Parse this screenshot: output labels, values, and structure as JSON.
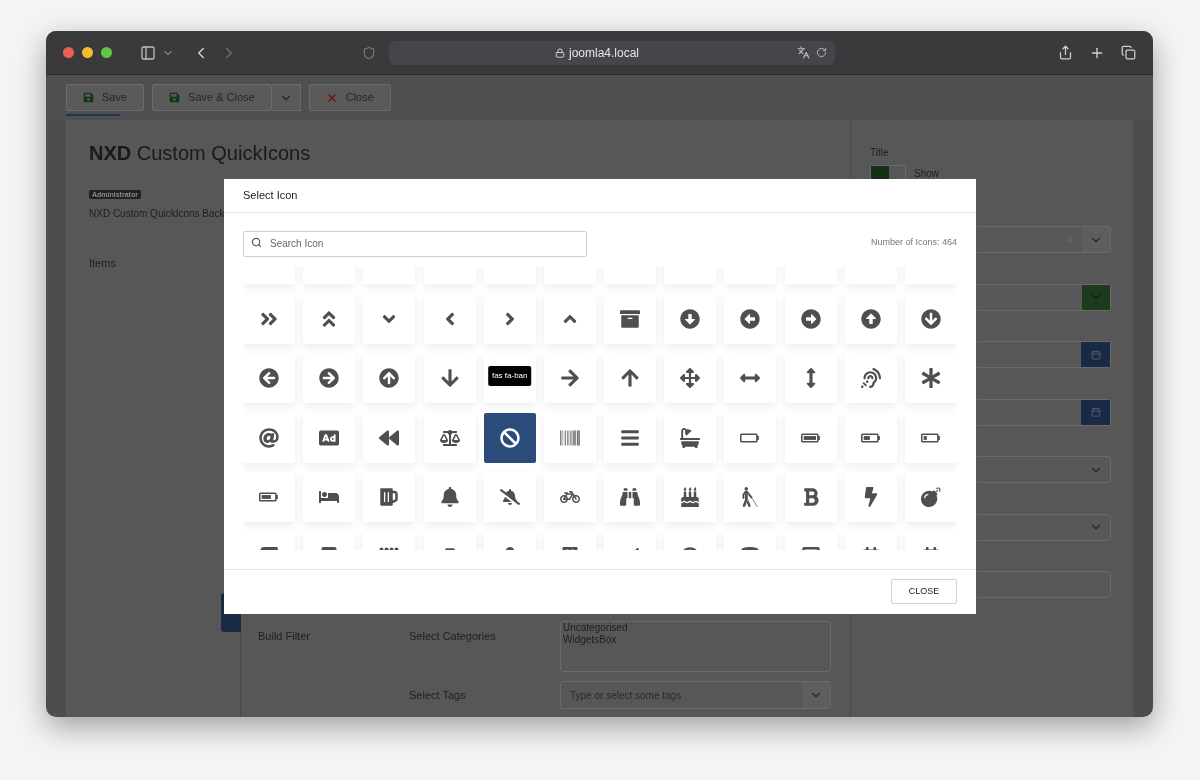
{
  "browser": {
    "url": "joomla4.local"
  },
  "toolbar": {
    "buttons": [
      {
        "label": "Save",
        "kind": "save"
      },
      {
        "label": "Save & Close",
        "kind": "save-split"
      },
      {
        "label": "Close",
        "kind": "close"
      }
    ]
  },
  "page": {
    "title": "**NXD** Custom QuickIcons",
    "badge": "Administrator",
    "description": "NXD Custom QuickIcons Back",
    "tab": "Items"
  },
  "sidebar": {
    "title_label": "Title",
    "toggle": {
      "on": true,
      "label": "Show"
    },
    "fields": [
      {
        "kind": "clearable-select"
      },
      {
        "kind": "select-active"
      },
      {
        "kind": "date"
      },
      {
        "kind": "date"
      },
      {
        "kind": "select"
      },
      {
        "kind": "select"
      },
      {
        "kind": "text"
      }
    ]
  },
  "filter": {
    "label": "Build Filter",
    "categories_label": "Select Categories",
    "categories": [
      "Uncategorised",
      "WidgetsBox"
    ],
    "tags_label": "Select Tags",
    "tags_placeholder": "Type or select some tags"
  },
  "modal": {
    "title": "Select Icon",
    "search_placeholder": "Search Icon",
    "count": "Number of Icons: 464",
    "close": "CLOSE",
    "icons": [
      {
        "selected": false
      },
      {
        "selected": false
      },
      {
        "selected": false
      },
      {
        "selected": false
      },
      {
        "selected": false
      },
      {
        "selected": false
      },
      {
        "selected": false
      },
      {
        "selected": false
      },
      {
        "selected": false
      },
      {
        "selected": false
      },
      {
        "selected": false
      },
      {
        "selected": false
      },
      {
        "selected": false
      },
      {
        "selected": false
      },
      {
        "selected": false
      },
      {
        "selected": false
      },
      {
        "selected": false
      },
      {
        "selected": false
      },
      {
        "selected": false
      },
      {
        "selected": false
      },
      {
        "selected": false
      },
      {
        "selected": false
      },
      {
        "selected": false
      },
      {
        "selected": false
      },
      {
        "selected": false
      },
      {
        "selected": false
      },
      {
        "selected": false
      },
      {
        "selected": false
      },
      {
        "selected": false
      },
      {
        "selected": false
      },
      {
        "selected": false
      },
      {
        "selected": false
      },
      {
        "selected": false
      },
      {
        "selected": false
      },
      {
        "selected": false
      },
      {
        "selected": false
      },
      {
        "selected": false
      },
      {
        "selected": false
      },
      {
        "selected": false
      },
      {
        "selected": false
      },
      {
        "selected": true,
        "tooltip": "fas fa-ban"
      },
      {
        "selected": false
      },
      {
        "selected": false
      },
      {
        "selected": false
      },
      {
        "selected": false
      },
      {
        "selected": false
      },
      {
        "selected": false
      },
      {
        "selected": false
      },
      {
        "selected": false
      },
      {
        "selected": false
      },
      {
        "selected": false
      },
      {
        "selected": false
      },
      {
        "selected": false
      },
      {
        "selected": false
      },
      {
        "selected": false
      },
      {
        "selected": false
      },
      {
        "selected": false
      },
      {
        "selected": false
      },
      {
        "selected": false
      },
      {
        "selected": false
      },
      {
        "selected": false
      },
      {
        "selected": false
      },
      {
        "selected": false
      },
      {
        "selected": false
      },
      {
        "selected": false
      },
      {
        "selected": false
      },
      {
        "selected": false
      },
      {
        "selected": false
      },
      {
        "selected": false
      },
      {
        "selected": false
      },
      {
        "selected": false
      },
      {
        "selected": false
      }
    ]
  }
}
